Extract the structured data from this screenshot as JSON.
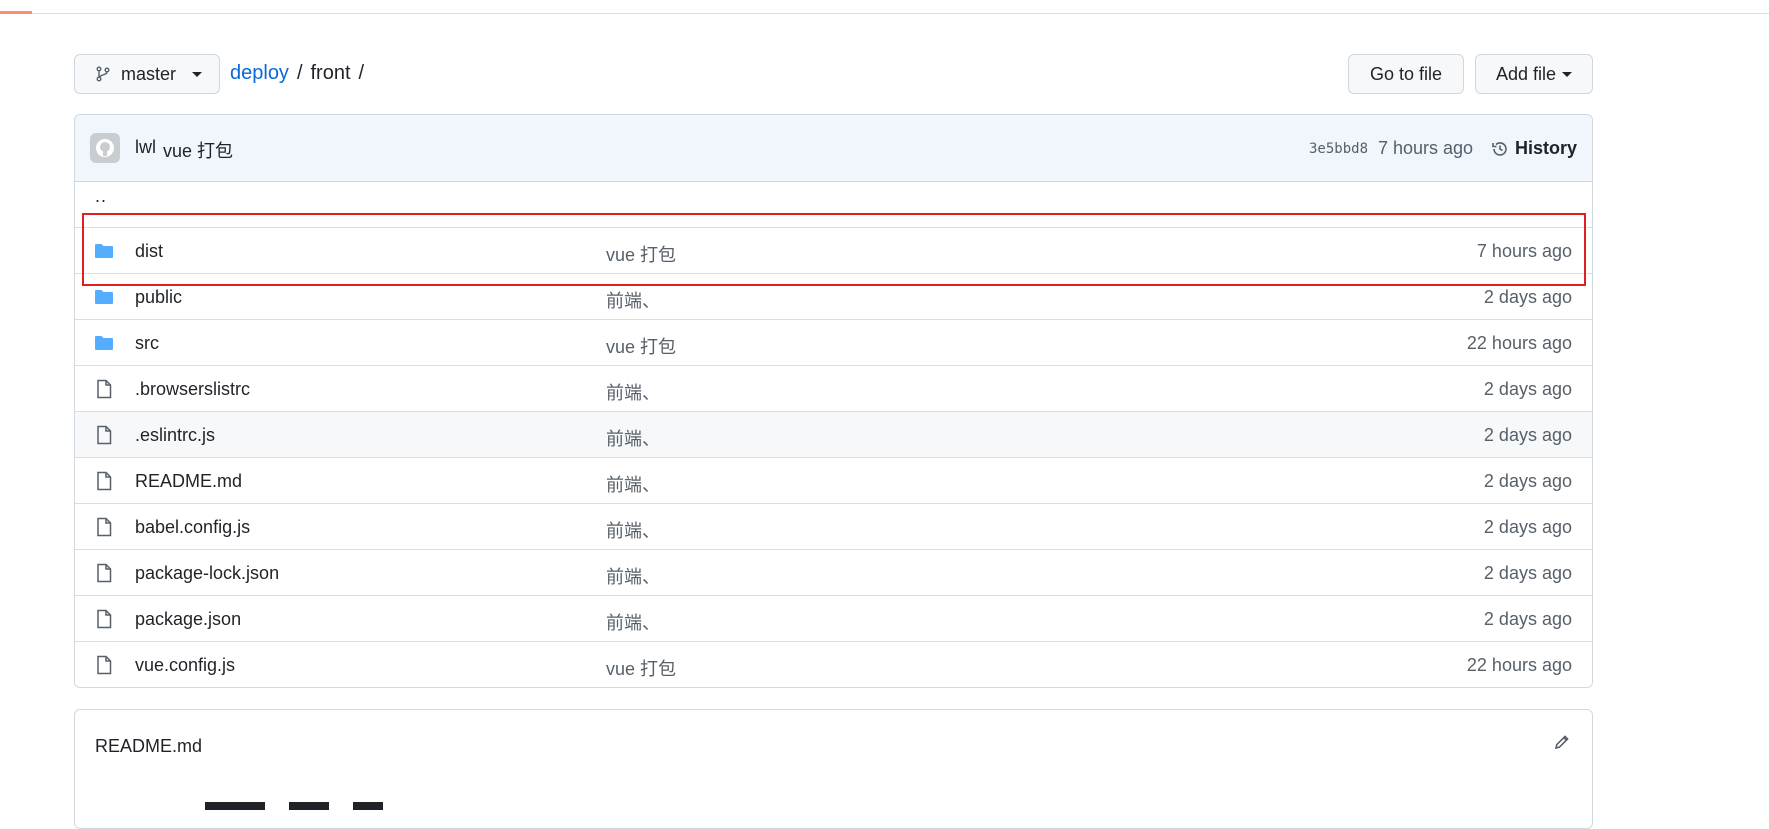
{
  "repo_header": {
    "branch": "master",
    "breadcrumb_repo": "deploy",
    "breadcrumb_sep": "/",
    "breadcrumb_dir": "front",
    "breadcrumb_trail": "/",
    "go_to_file": "Go to file",
    "add_file": "Add file"
  },
  "commit": {
    "author": "lwl",
    "message": "vue 打包",
    "sha": "3e5bbd8",
    "time": "7 hours ago",
    "history_label": "History"
  },
  "parent_link": "..",
  "files": [
    {
      "type": "folder",
      "name": "dist",
      "message": "vue 打包",
      "age": "7 hours ago"
    },
    {
      "type": "folder",
      "name": "public",
      "message": "前端、",
      "age": "2 days ago"
    },
    {
      "type": "folder",
      "name": "src",
      "message": "vue 打包",
      "age": "22 hours ago"
    },
    {
      "type": "file",
      "name": ".browserslistrc",
      "message": "前端、",
      "age": "2 days ago"
    },
    {
      "type": "file",
      "name": ".eslintrc.js",
      "message": "前端、",
      "age": "2 days ago"
    },
    {
      "type": "file",
      "name": "README.md",
      "message": "前端、",
      "age": "2 days ago"
    },
    {
      "type": "file",
      "name": "babel.config.js",
      "message": "前端、",
      "age": "2 days ago"
    },
    {
      "type": "file",
      "name": "package-lock.json",
      "message": "前端、",
      "age": "2 days ago"
    },
    {
      "type": "file",
      "name": "package.json",
      "message": "前端、",
      "age": "2 days ago"
    },
    {
      "type": "file",
      "name": "vue.config.js",
      "message": "vue 打包",
      "age": "22 hours ago"
    }
  ],
  "readme": {
    "title": "README.md"
  },
  "colors": {
    "link": "#0969da",
    "folder": "#54aeff",
    "highlight_border": "#e02020",
    "commit_bar_bg": "#f0f6fc"
  },
  "icons": {
    "branch": "git-branch-icon",
    "history": "history-clock-icon",
    "folder": "folder-icon",
    "file": "file-icon",
    "edit": "pencil-icon"
  }
}
